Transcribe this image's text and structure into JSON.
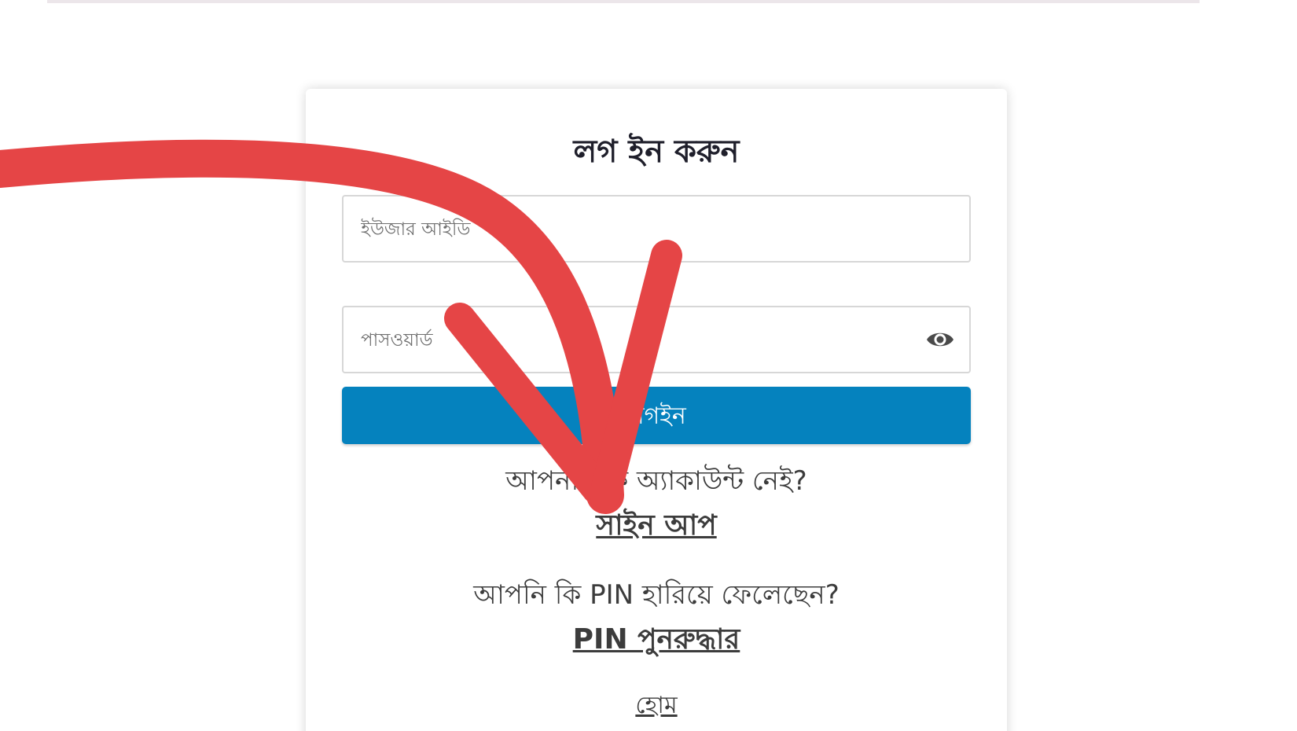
{
  "login": {
    "title": "লগ ইন করুন",
    "user_placeholder": "ইউজার আইডি",
    "password_placeholder": "পাসওয়ার্ড",
    "login_button": "লগইন",
    "no_account_text": "আপনার কি অ্যাকাউন্ট নেই?",
    "signup_link": "সাইন আপ",
    "lost_pin_text": "আপনি কি PIN হারিয়ে ফেলেছেন?",
    "pin_recovery_link": "PIN পুনরুদ্ধার",
    "home_link": "হোম"
  },
  "icons": {
    "password_toggle": "eye-icon"
  },
  "colors": {
    "primary_button": "#0582be",
    "annotation_arrow": "#e54546",
    "title_text": "#1f1f2b",
    "body_text": "#3c3c3c"
  }
}
